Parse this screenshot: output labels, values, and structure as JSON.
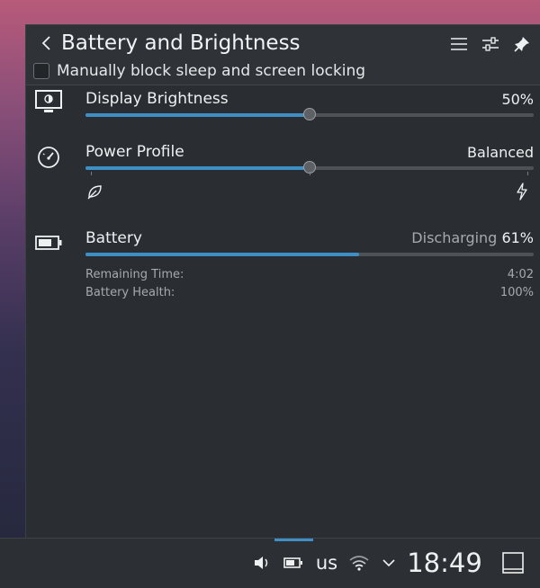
{
  "header": {
    "title": "Battery and Brightness",
    "block_sleep_label": "Manually block sleep and screen locking"
  },
  "brightness": {
    "label": "Display Brightness",
    "value_text": "50%",
    "level": 0.5
  },
  "power_profile": {
    "label": "Power Profile",
    "value_text": "Balanced",
    "options": [
      "Power Save",
      "Balanced",
      "Performance"
    ],
    "selected_index": 1
  },
  "battery": {
    "label": "Battery",
    "state": "Discharging",
    "percent_text": "61%",
    "level": 0.61,
    "remaining_label": "Remaining Time:",
    "remaining_value": "4:02",
    "health_label": "Battery Health:",
    "health_value": "100%"
  },
  "taskbar": {
    "keyboard_layout": "us",
    "clock": "18:49"
  },
  "colors": {
    "accent": "#3d8fc6",
    "panel": "#2a2e32",
    "text": "#eff0f1"
  }
}
